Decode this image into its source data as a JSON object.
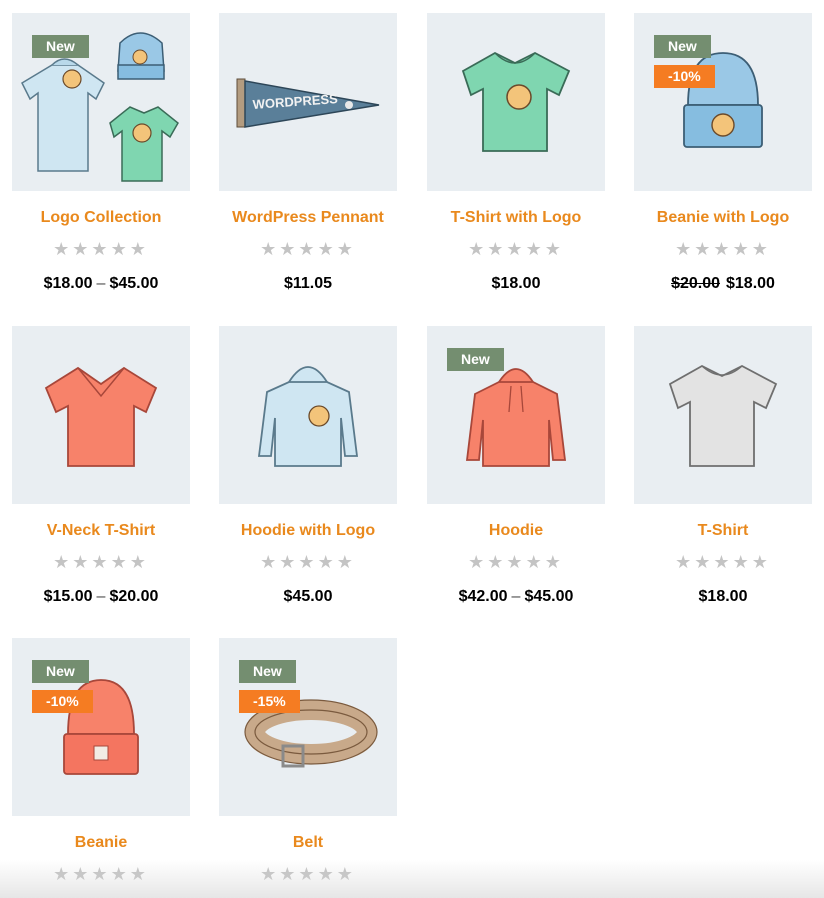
{
  "products": [
    {
      "name": "Logo Collection",
      "badges": [
        "New"
      ],
      "price_from": "$18.00",
      "price_sep": "–",
      "price_to": "$45.00"
    },
    {
      "name": "WordPress Pennant",
      "badges": [],
      "price": "$11.05"
    },
    {
      "name": "T-Shirt with Logo",
      "badges": [],
      "price": "$18.00"
    },
    {
      "name": "Beanie with Logo",
      "badges": [
        "New",
        "-10%"
      ],
      "price_old": "$20.00",
      "price": "$18.00"
    },
    {
      "name": "V-Neck T-Shirt",
      "badges": [],
      "price_from": "$15.00",
      "price_sep": "–",
      "price_to": "$20.00"
    },
    {
      "name": "Hoodie with Logo",
      "badges": [],
      "price": "$45.00"
    },
    {
      "name": "Hoodie",
      "badges": [
        "New"
      ],
      "price_from": "$42.00",
      "price_sep": "–",
      "price_to": "$45.00"
    },
    {
      "name": "T-Shirt",
      "badges": [],
      "price": "$18.00"
    },
    {
      "name": "Beanie",
      "badges": [
        "New",
        "-10%"
      ]
    },
    {
      "name": "Belt",
      "badges": [
        "New",
        "-15%"
      ]
    }
  ],
  "pennant_text": "WORDPRESS",
  "stars": "★★★★★",
  "colors": {
    "title": "#e9891d",
    "new_badge": "#748e70",
    "sale_badge": "#f57c22",
    "thumb_bg": "#e9eef2",
    "star": "#c4c4c4"
  }
}
